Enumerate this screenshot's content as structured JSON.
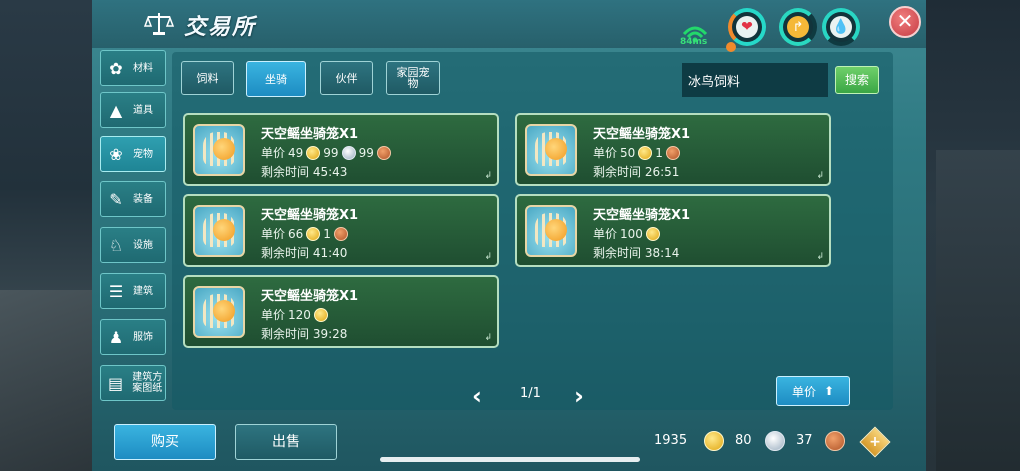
{
  "window": {
    "title": "交易所"
  },
  "status": {
    "ping": "84ms"
  },
  "sidebar": {
    "items": [
      {
        "label": "材料",
        "icon": "material-icon"
      },
      {
        "label": "道具",
        "icon": "item-icon"
      },
      {
        "label": "宠物",
        "icon": "pet-paw-icon",
        "active": true
      },
      {
        "label": "装备",
        "icon": "equipment-icon"
      },
      {
        "label": "设施",
        "icon": "facility-icon"
      },
      {
        "label": "建筑",
        "icon": "building-icon"
      },
      {
        "label": "服饰",
        "icon": "clothing-icon"
      },
      {
        "label": "建筑方案图纸",
        "icon": "blueprint-icon"
      }
    ]
  },
  "tabs": [
    {
      "label": "饲料",
      "active": false
    },
    {
      "label": "坐骑",
      "active": true
    },
    {
      "label": "伙伴",
      "active": false
    },
    {
      "label": "家园宠物",
      "active": false
    }
  ],
  "search": {
    "value": "冰鸟饲料",
    "button_label": "搜索"
  },
  "listings": [
    {
      "name": "天空鳐坐骑笼X1",
      "price_label": "单价",
      "gold": "49",
      "silver": "99",
      "copper": "99",
      "time_label": "剩余时间",
      "time": "45:43"
    },
    {
      "name": "天空鳐坐骑笼X1",
      "price_label": "单价",
      "gold": "50",
      "copper": "1",
      "time_label": "剩余时间",
      "time": "26:51"
    },
    {
      "name": "天空鳐坐骑笼X1",
      "price_label": "单价",
      "gold": "66",
      "copper": "1",
      "time_label": "剩余时间",
      "time": "41:40"
    },
    {
      "name": "天空鳐坐骑笼X1",
      "price_label": "单价",
      "gold": "100",
      "time_label": "剩余时间",
      "time": "38:14"
    },
    {
      "name": "天空鳐坐骑笼X1",
      "price_label": "单价",
      "gold": "120",
      "time_label": "剩余时间",
      "time": "39:28"
    }
  ],
  "pager": {
    "current": "1/1"
  },
  "sort": {
    "label": "单价"
  },
  "actions": {
    "buy_label": "购买",
    "sell_label": "出售"
  },
  "wallet": {
    "gold": "1935",
    "silver": "80",
    "copper": "37"
  },
  "colors": {
    "gold": "#e0a612",
    "silver": "#9aaec0",
    "copper": "#b05428",
    "accent": "#1d8cc2",
    "card_bg": "#2e6b40"
  }
}
